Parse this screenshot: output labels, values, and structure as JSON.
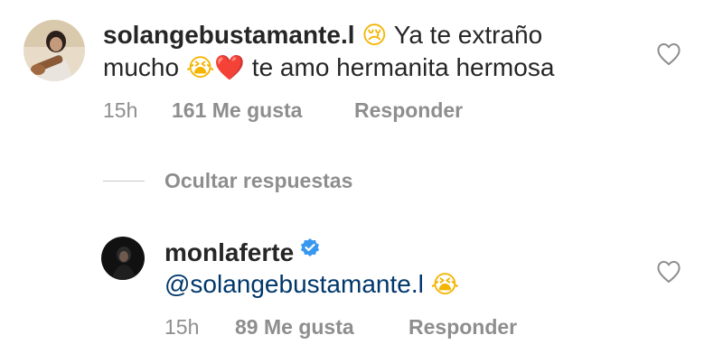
{
  "comments": [
    {
      "username": "solangebustamante.l",
      "text_part1": " Ya te extraño",
      "text_part2": "mucho ",
      "text_part3": " te amo hermanita hermosa",
      "emoji_cry": "😢",
      "emoji_sob": "😭",
      "emoji_heart": "❤️",
      "time": "15h",
      "likes": "161 Me gusta",
      "reply_label": "Responder"
    },
    {
      "username": "monlaferte",
      "mention": "@solangebustamante.l",
      "emoji_sob": "😭",
      "time": "15h",
      "likes": "89 Me gusta",
      "reply_label": "Responder"
    }
  ],
  "hide_replies_label": "Ocultar respuestas",
  "colors": {
    "text": "#262626",
    "secondary": "#8e8e8e",
    "mention": "#00376b",
    "verified": "#3897f0",
    "heart_emoji": "#e0245e"
  },
  "icons": {
    "like": "heart-outline-icon",
    "verified": "verified-badge-icon"
  }
}
